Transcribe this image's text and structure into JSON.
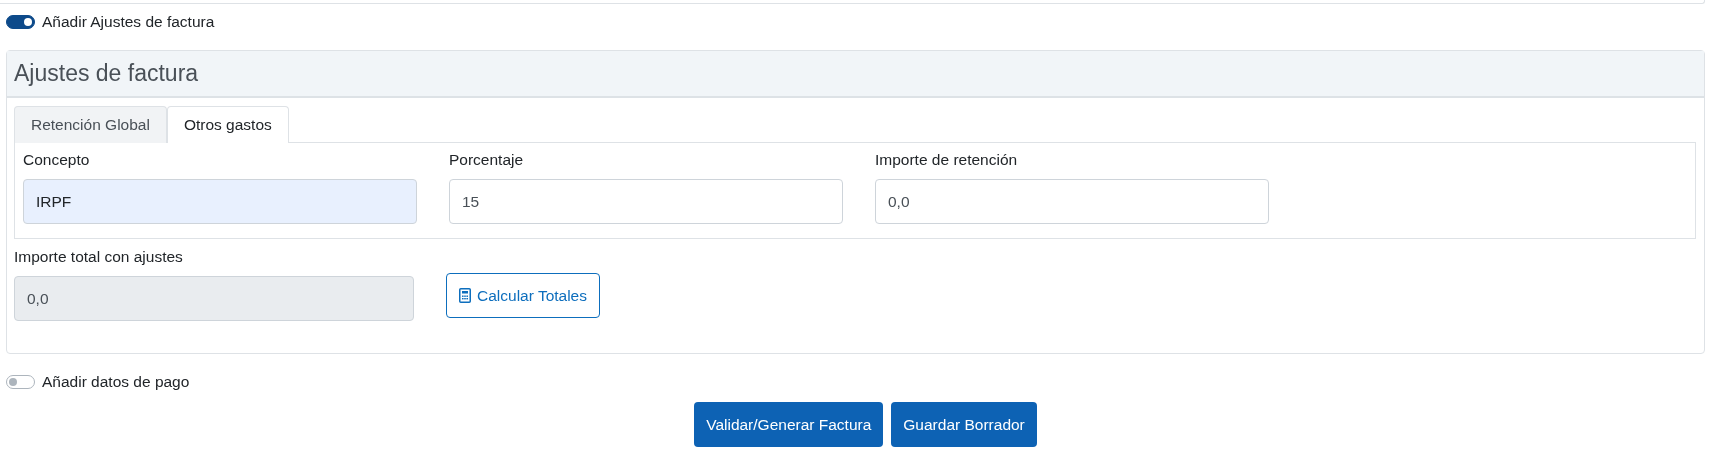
{
  "adjust_toggle": {
    "label": "Añadir Ajustes de factura",
    "on": true
  },
  "card": {
    "title": "Ajustes de factura",
    "tabs": [
      {
        "label": "Retención Global",
        "selected": false
      },
      {
        "label": "Otros gastos",
        "selected": true
      }
    ],
    "fields": [
      {
        "label": "Concepto",
        "value": "IRPF",
        "highlighted": true
      },
      {
        "label": "Porcentaje",
        "value": "15",
        "highlighted": false
      },
      {
        "label": "Importe de retención",
        "value": "0,0",
        "highlighted": false
      }
    ],
    "total": {
      "label": "Importe total con ajustes",
      "value": "0,0",
      "disabled": true
    },
    "calc_button": "Calcular Totales"
  },
  "payment_toggle": {
    "label": "Añadir datos de pago",
    "on": false
  },
  "buttons": [
    "Validar/Generar Factura",
    "Guardar Borrador"
  ]
}
